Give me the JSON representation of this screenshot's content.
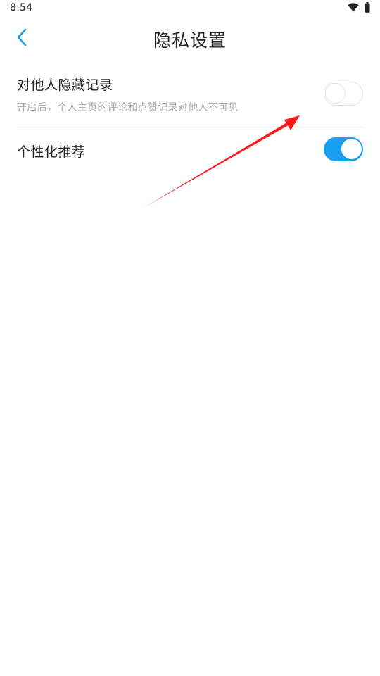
{
  "status_bar": {
    "time": "8:54"
  },
  "header": {
    "title": "隐私设置",
    "back_icon": "chevron-left-icon"
  },
  "settings": [
    {
      "title": "对他人隐藏记录",
      "description": "开启后，个人主页的评论和点赞记录对他人不可见",
      "toggle_state": "off"
    },
    {
      "title": "个性化推荐",
      "toggle_state": "on"
    }
  ],
  "colors": {
    "accent": "#1a9ef0",
    "title_text": "#222222",
    "secondary_text": "#aaaaaa",
    "annotation_arrow": "#ff0000"
  }
}
